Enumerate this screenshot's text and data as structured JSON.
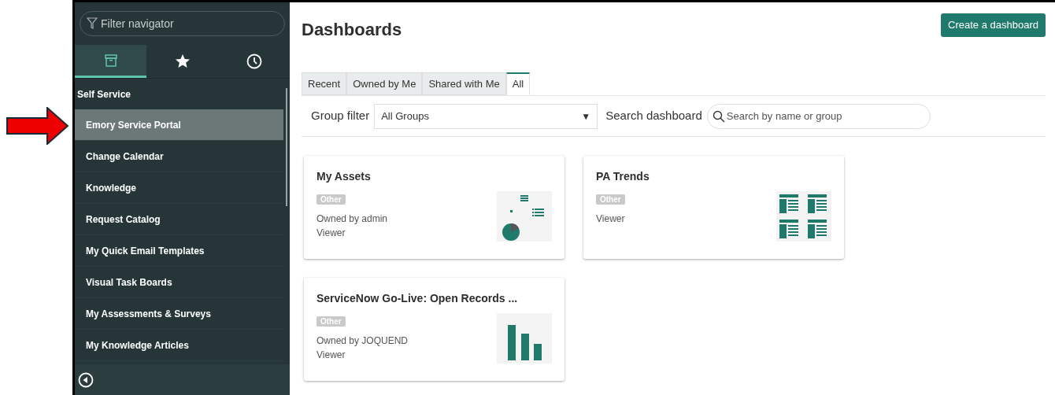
{
  "sidebar": {
    "filter": {
      "placeholder": "Filter navigator"
    },
    "tabs": [
      {
        "kind": "archive",
        "selected": true
      },
      {
        "kind": "star",
        "selected": false
      },
      {
        "kind": "clock",
        "selected": false
      }
    ],
    "section": "Self Service",
    "items": [
      {
        "label": "Emory Service Portal",
        "selected": true
      },
      {
        "label": "Change Calendar",
        "selected": false
      },
      {
        "label": "Knowledge",
        "selected": false
      },
      {
        "label": "Request Catalog",
        "selected": false
      },
      {
        "label": "My Quick Email Templates",
        "selected": false
      },
      {
        "label": "Visual Task Boards",
        "selected": false
      },
      {
        "label": "My Assessments & Surveys",
        "selected": false
      },
      {
        "label": "My Knowledge Articles",
        "selected": false
      }
    ]
  },
  "main": {
    "title": "Dashboards",
    "create_button": "Create a dashboard",
    "tabs": [
      {
        "label": "Recent",
        "selected": false
      },
      {
        "label": "Owned by Me",
        "selected": false
      },
      {
        "label": "Shared with Me",
        "selected": false
      },
      {
        "label": "All",
        "selected": true
      }
    ],
    "group_filter": {
      "label": "Group filter",
      "value": "All Groups",
      "caret": "▼"
    },
    "search": {
      "label": "Search dashboard",
      "placeholder": "Search by name or group"
    },
    "cards": [
      {
        "title": "My Assets",
        "tag": "Other",
        "owner": "Owned by admin",
        "role": "Viewer",
        "thumbnail": {
          "kind": "assets"
        }
      },
      {
        "title": "PA Trends",
        "tag": "Other",
        "role": "Viewer",
        "thumbnail": {
          "kind": "lists"
        }
      },
      {
        "title": "ServiceNow Go-Live: Open Records ...",
        "tag": "Other",
        "owner": "Owned by JOQUEND",
        "role": "Viewer",
        "thumbnail": {
          "kind": "bars"
        }
      }
    ]
  }
}
